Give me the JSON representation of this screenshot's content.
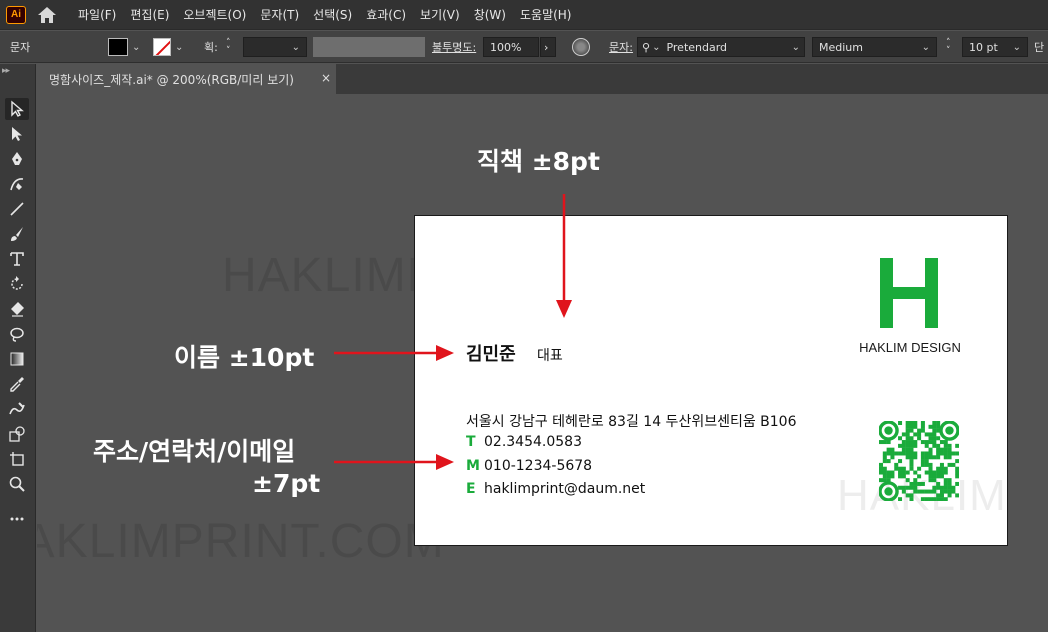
{
  "app": {
    "logo_text": "Ai",
    "menu": [
      "파일(F)",
      "편집(E)",
      "오브젝트(O)",
      "문자(T)",
      "선택(S)",
      "효과(C)",
      "보기(V)",
      "창(W)",
      "도움말(H)"
    ]
  },
  "control_bar": {
    "context_label": "문자",
    "stroke_label": "획:",
    "opacity_label": "불투명도:",
    "opacity_value": "100%",
    "char_label": "문자:",
    "font_family": "Pretendard",
    "font_style": "Medium",
    "font_size": "10 pt",
    "paragraph_label": "단"
  },
  "document": {
    "tab_title": "명함사이즈_제작.ai* @ 200%(RGB/미리 보기)",
    "close_glyph": "×"
  },
  "watermark": "HAKLIMPRINT.COM",
  "watermark_card": "HAKLIMPRINT.COM",
  "card": {
    "logo_letter": "H",
    "brand": "HAKLIM DESIGN",
    "name": "김민준",
    "title": "대표",
    "address": "서울시 강남구 테헤란로 83길 14 두산위브센티움 B106",
    "contacts": [
      {
        "letter": "T",
        "value": "02.3454.0583"
      },
      {
        "letter": "M",
        "value": "010-1234-5678"
      },
      {
        "letter": "E",
        "value": "haklimprint@daum.net"
      }
    ],
    "accent_color": "#1aab3b"
  },
  "annotations": {
    "title_size": "직책 ±8pt",
    "name_size": "이름 ±10pt",
    "info_line1": "주소/연락처/이메일",
    "info_line2": "±7pt",
    "arrow_color": "#e0141c"
  },
  "icons": [
    "home-icon",
    "selection-tool-icon",
    "direct-selection-tool-icon",
    "pen-tool-icon",
    "curvature-tool-icon",
    "line-tool-icon",
    "paintbrush-tool-icon",
    "type-tool-icon",
    "rotate-tool-icon",
    "eraser-tool-icon",
    "lasso-tool-icon",
    "gradient-tool-icon",
    "eyedropper-tool-icon",
    "blend-tool-icon",
    "live-paint-tool-icon",
    "artboard-tool-icon",
    "zoom-tool-icon",
    "more-tools-icon",
    "recolor-icon",
    "search-icon"
  ]
}
